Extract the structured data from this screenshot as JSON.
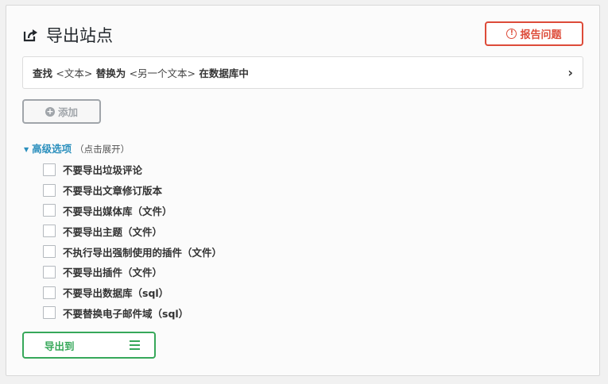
{
  "header": {
    "title": "导出站点",
    "icon": "share-export-icon",
    "report_label": "报告问题",
    "report_icon": "exclamation-circle-icon"
  },
  "find_replace": {
    "prefix": "查找",
    "find_tag": "<文本>",
    "middle": "替换为",
    "replace_tag": "<另一个文本>",
    "suffix": "在数据库中",
    "chevron_icon": "chevron-right-icon"
  },
  "add": {
    "label": "添加",
    "icon": "plus-circle-icon"
  },
  "advanced": {
    "label": "高级选项",
    "hint": "（点击展开）",
    "icon": "triangle-down-icon"
  },
  "options": [
    {
      "label": "不要导出垃圾评论",
      "checked": false
    },
    {
      "label": "不要导出文章修订版本",
      "checked": false
    },
    {
      "label": "不要导出媒体库（文件）",
      "checked": false
    },
    {
      "label": "不要导出主题（文件）",
      "checked": false
    },
    {
      "label": "不执行导出强制使用的插件（文件）",
      "checked": false
    },
    {
      "label": "不要导出插件（文件）",
      "checked": false
    },
    {
      "label": "不要导出数据库（sql）",
      "checked": false
    },
    {
      "label": "不要替换电子邮件域（sql）",
      "checked": false
    }
  ],
  "export": {
    "label": "导出到",
    "icon": "hamburger-menu-icon"
  },
  "colors": {
    "report_red": "#dd4b39",
    "link_blue": "#2a8fbd",
    "export_green": "#37a85a",
    "disabled_gray": "#a0a5aa"
  }
}
